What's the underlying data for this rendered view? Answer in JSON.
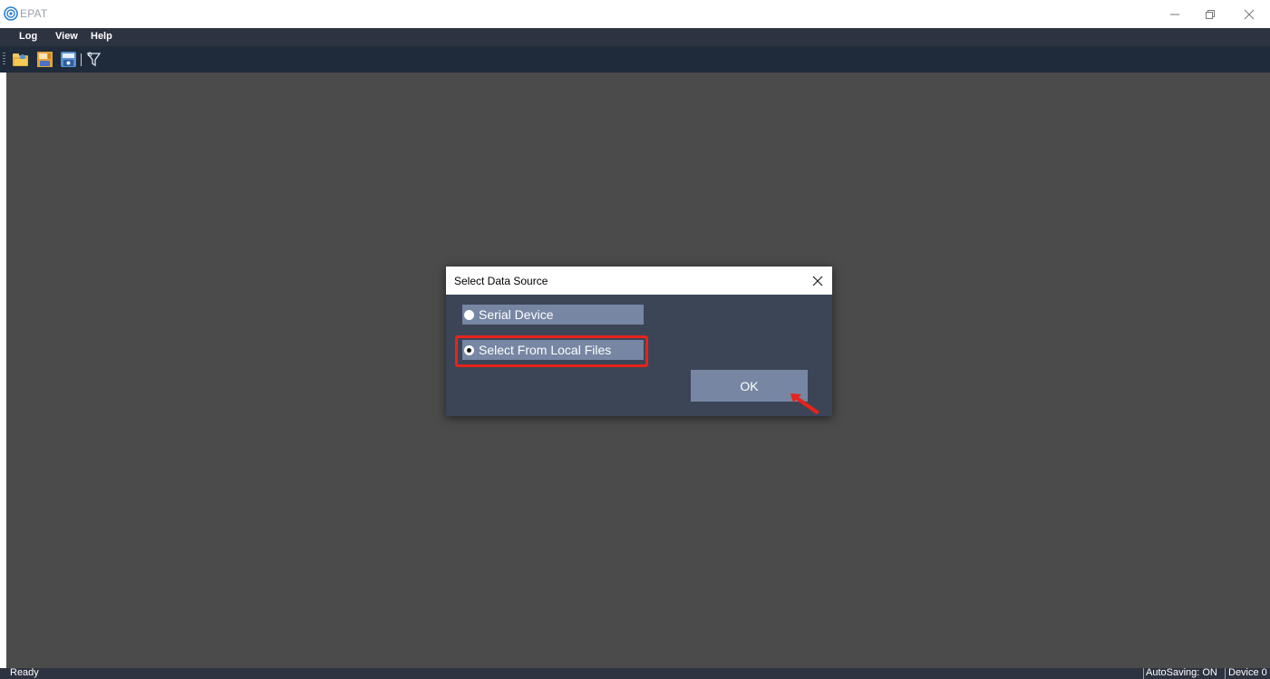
{
  "window": {
    "title": "EPAT",
    "controls": {
      "minimize": "—",
      "maximize": "❐",
      "close": "✕"
    }
  },
  "menubar": {
    "items": [
      {
        "label": "Log"
      },
      {
        "label": "View"
      },
      {
        "label": "Help"
      }
    ]
  },
  "toolbar": {
    "icons": [
      "open-folder-icon",
      "save-icon",
      "export-icon",
      "filter-icon"
    ]
  },
  "dialog": {
    "title": "Select Data Source",
    "options": [
      {
        "label": "Serial Device",
        "selected": false
      },
      {
        "label": "Select From Local Files",
        "selected": true
      }
    ],
    "ok_label": "OK"
  },
  "statusbar": {
    "left": "Ready",
    "autosave": "AutoSaving: ON",
    "device": "Device 0"
  },
  "colors": {
    "accent_highlight": "#e8231b",
    "dialog_bg": "#3c4556",
    "option_bg": "#7686a3",
    "workspace_bg": "#4b4b4b",
    "menubar_bg": "#2d3340",
    "toolbar_bg": "#1f2b3a"
  }
}
